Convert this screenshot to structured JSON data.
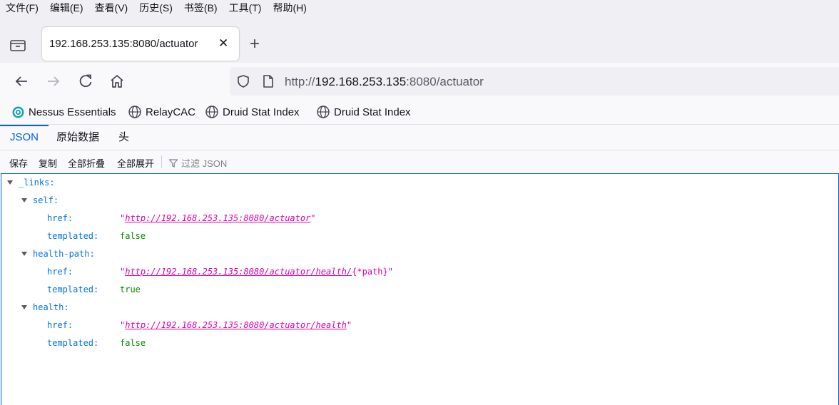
{
  "menu": [
    "文件(F)",
    "编辑(E)",
    "查看(V)",
    "历史(S)",
    "书签(B)",
    "工具(T)",
    "帮助(H)"
  ],
  "tab": {
    "title": "192.168.253.135:8080/actuator",
    "close": "✕",
    "new_tab": "+"
  },
  "url": {
    "prefix": "http://",
    "host": "192.168.253.135",
    "rest": ":8080/actuator"
  },
  "bookmarks": [
    "Nessus Essentials",
    "RelayCAC",
    "Druid Stat Index",
    "Druid Stat Index"
  ],
  "viewer_tabs": [
    "JSON",
    "原始数据",
    "头"
  ],
  "toolbar": {
    "save": "保存",
    "copy": "复制",
    "collapse_all": "全部折叠",
    "expand_all": "全部展开",
    "filter_placeholder": "过滤 JSON"
  },
  "json": {
    "root_key": "_links:",
    "groups": [
      {
        "key": "self:",
        "href_label": "href:",
        "href_quote_open": "\"",
        "href_link": "http://192.168.253.135:8080/actuator",
        "href_suffix": "\"",
        "templated_label": "templated:",
        "templated": "false"
      },
      {
        "key": "health-path:",
        "href_label": "href:",
        "href_quote_open": "\"",
        "href_link": "http://192.168.253.135:8080/actuator/health/",
        "href_suffix": "{*path}\"",
        "templated_label": "templated:",
        "templated": "true"
      },
      {
        "key": "health:",
        "href_label": "href:",
        "href_quote_open": "\"",
        "href_link": "http://192.168.253.135:8080/actuator/health",
        "href_suffix": "\"",
        "templated_label": "templated:",
        "templated": "false"
      }
    ]
  },
  "colors": {
    "accent": "#0060df",
    "json_key": "#0074e8",
    "json_string": "#dd00a9",
    "json_bool": "#058b00"
  }
}
